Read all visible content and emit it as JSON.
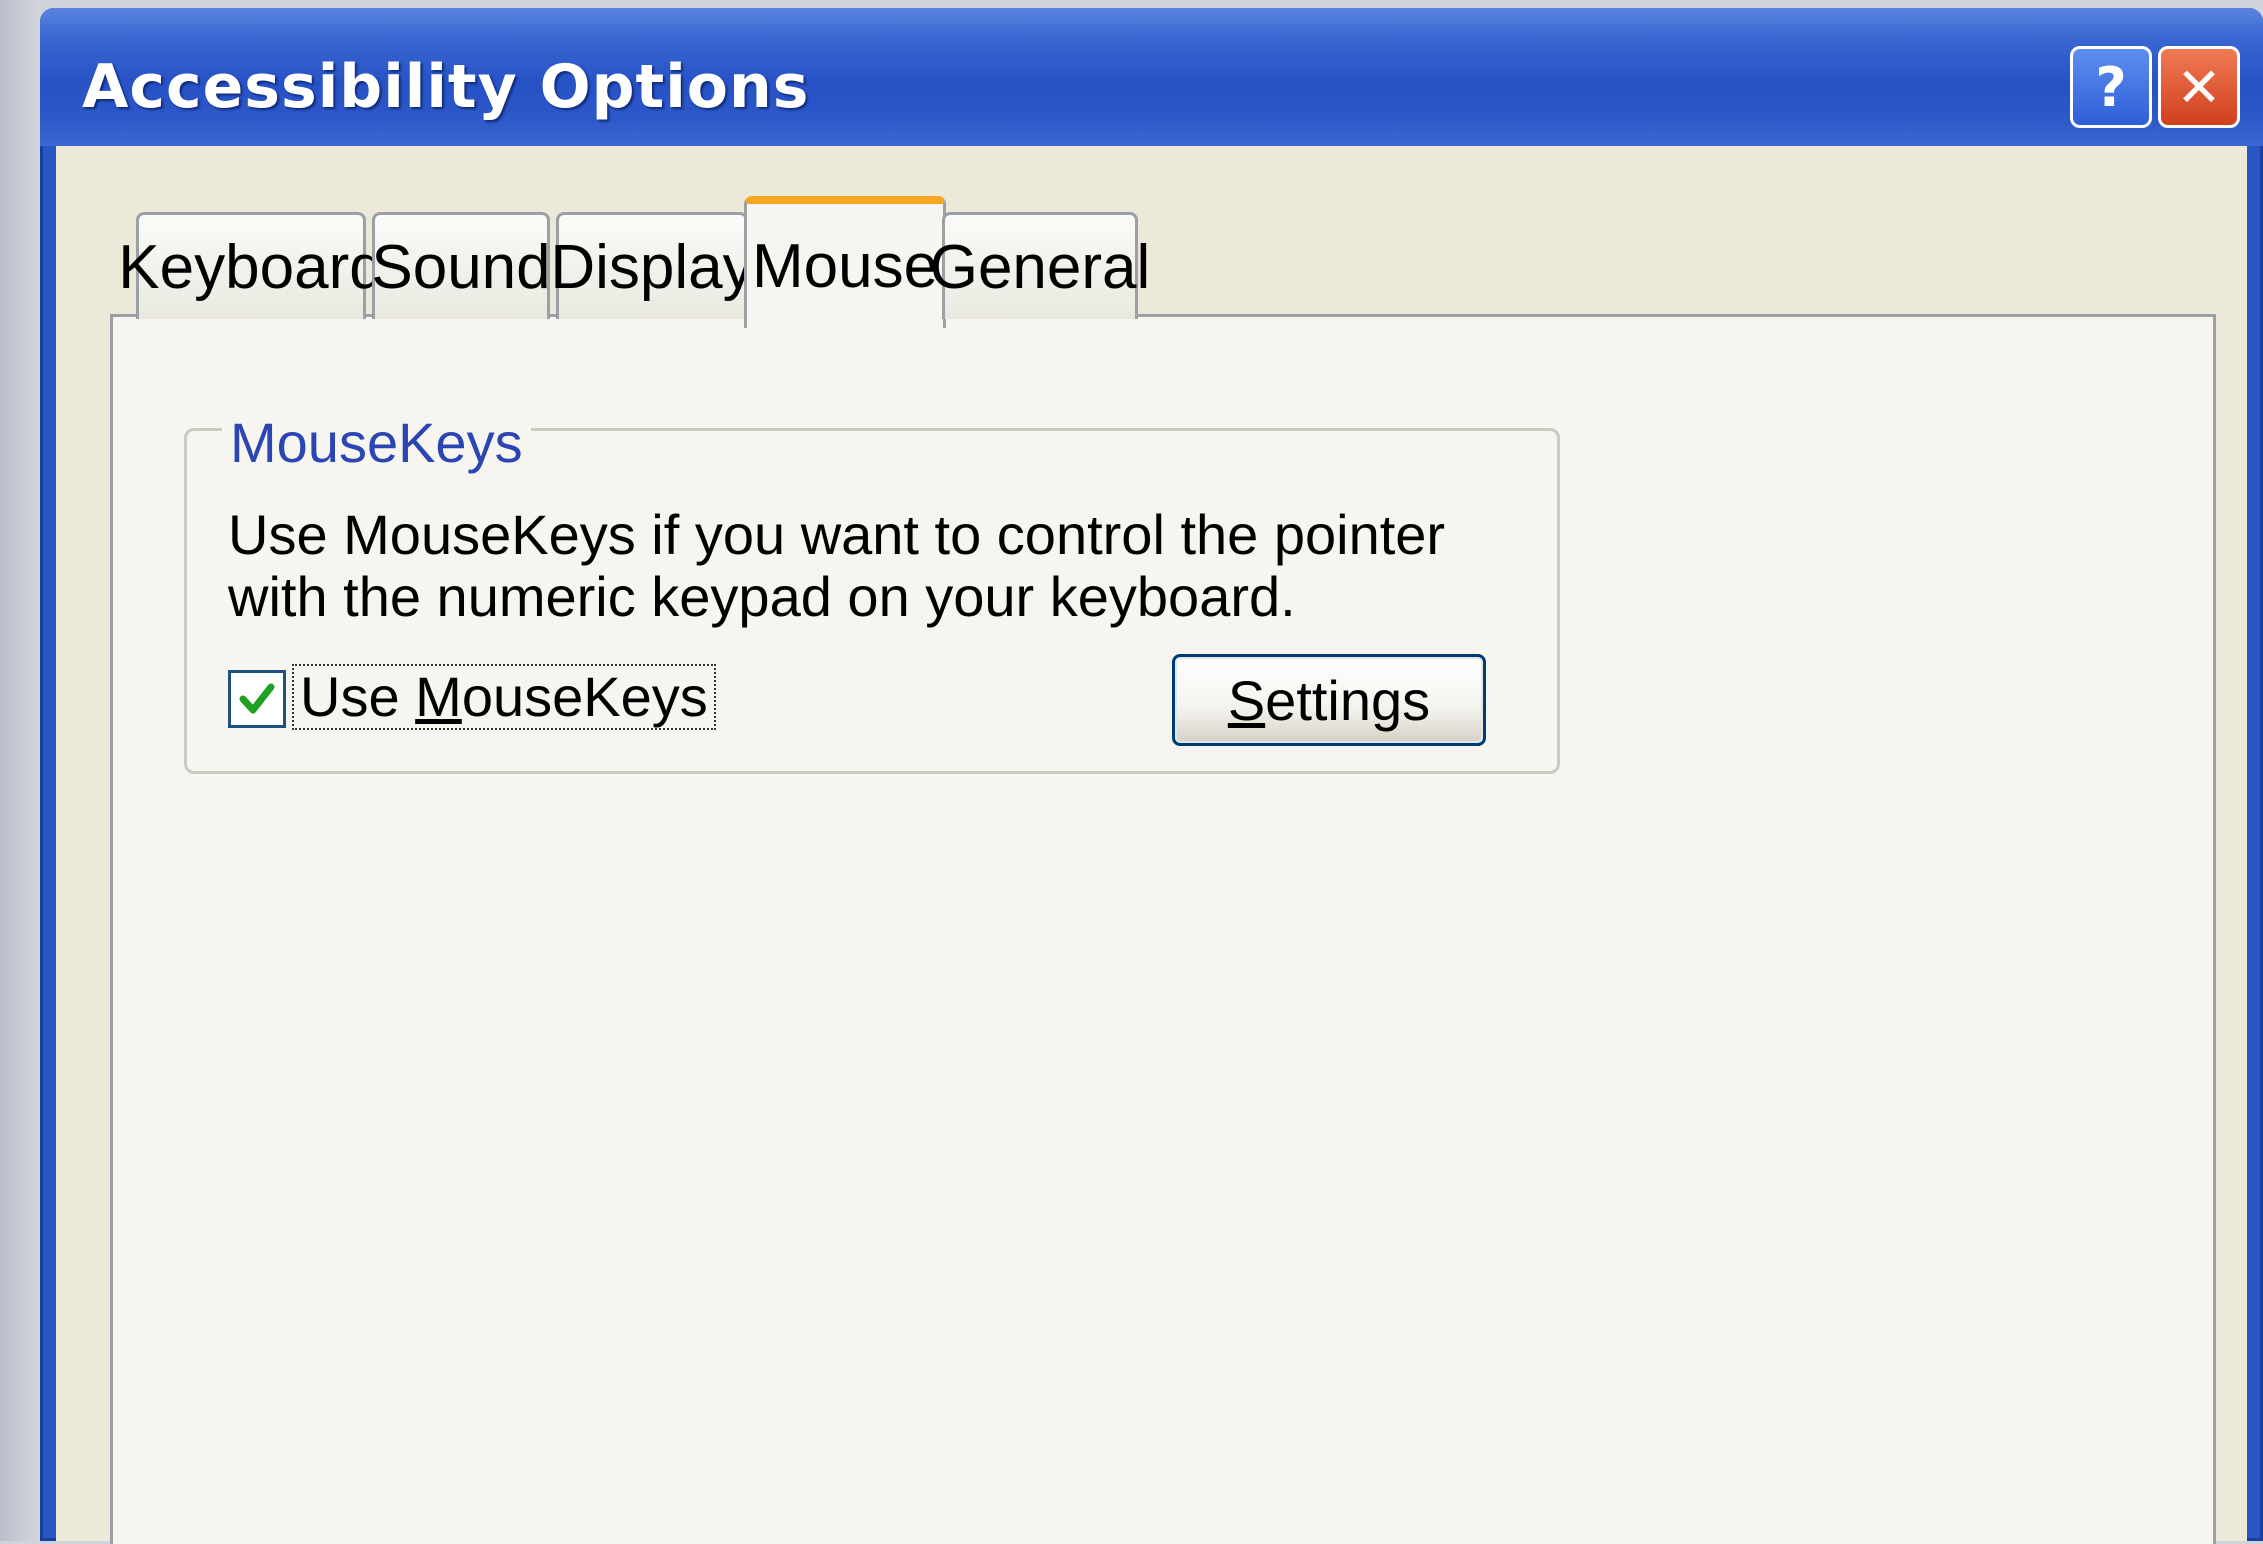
{
  "window": {
    "title": "Accessibility Options",
    "help_glyph": "?",
    "close_glyph": "✕"
  },
  "tabs": [
    {
      "label": "Keyboard",
      "active": false
    },
    {
      "label": "Sound",
      "active": false
    },
    {
      "label": "Display",
      "active": false
    },
    {
      "label": "Mouse",
      "active": true
    },
    {
      "label": "General",
      "active": false
    }
  ],
  "mousekeys": {
    "group_title": "MouseKeys",
    "description": "Use MouseKeys if you want to control the pointer with the numeric keypad on your keyboard.",
    "checkbox_checked": true,
    "checkbox_label_before": "Use ",
    "checkbox_label_accel": "M",
    "checkbox_label_after": "ouseKeys",
    "settings_accel": "S",
    "settings_rest": "ettings"
  },
  "icons": {
    "help": "help-icon",
    "close": "close-icon",
    "check": "checkmark-icon"
  },
  "colors": {
    "title_bar": "#2752c6",
    "active_tab_accent": "#f5a623",
    "group_title": "#2b46b3",
    "checkmark": "#21a121",
    "close_button": "#d0401d"
  }
}
